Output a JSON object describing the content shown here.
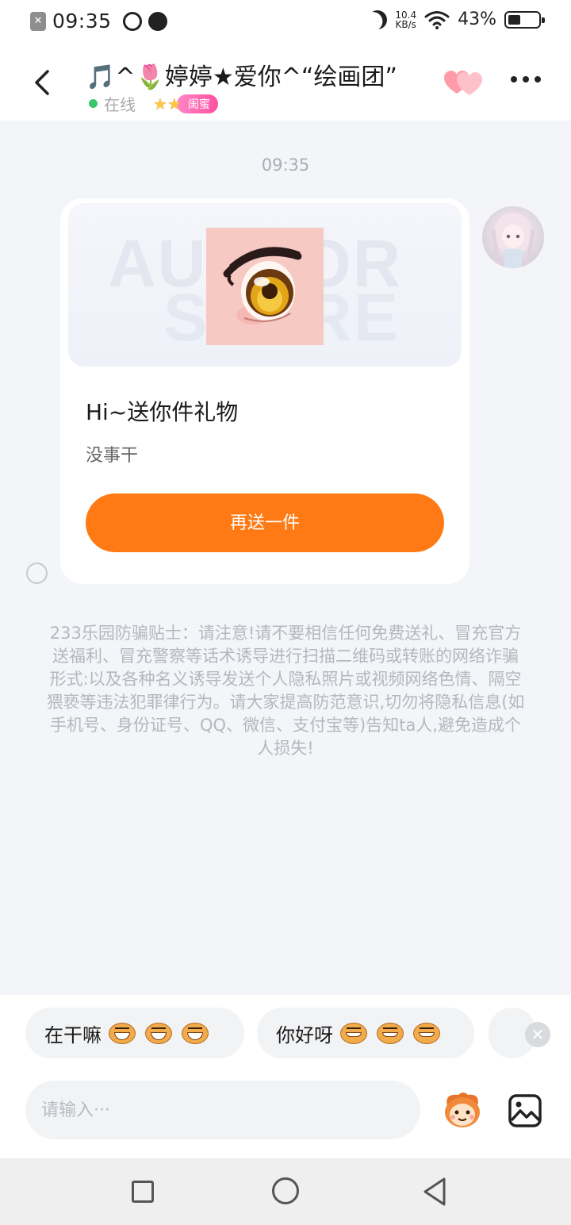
{
  "status_bar": {
    "time": "09:35",
    "net_speed_value": "10.4",
    "net_speed_unit": "KB/s",
    "battery_percent": "43%",
    "battery_level": 0.43
  },
  "header": {
    "title": "🎵^🌷婷婷★爱你^“绘画团”",
    "online_status": "在线",
    "relationship_badge": "闺蜜"
  },
  "chat": {
    "timestamp": "09:35",
    "gift_card": {
      "title": "Hi~送你件礼物",
      "subtitle": "没事干",
      "resend_label": "再送一件",
      "watermark_line1": "AUTHOR",
      "watermark_line2": "STORE"
    },
    "warning": "233乐园防骗贴士：请注意!请不要相信任何免费送礼、冒充官方送福利、冒充警察等话术诱导进行扫描二维码或转账的网络诈骗形式:以及各种名义诱导发送个人隐私照片或视频网络色情、隔空猥亵等违法犯罪律行为。请大家提高防范意识,切勿将隐私信息(如手机号、身份证号、QQ、微信、支付宝等)告知ta人,避免造成个人损失!"
  },
  "quick_replies": [
    {
      "text": "在干嘛"
    },
    {
      "text": "你好呀"
    }
  ],
  "input": {
    "placeholder": "请输入···"
  },
  "colors": {
    "accent": "#ff7a14",
    "online_dot": "#3cc46a",
    "badge": "#ff4fa0",
    "background": "#f3f5f8"
  },
  "icons": {
    "back": "chevron-left-icon",
    "hearts": "hearts-icon",
    "more": "more-dots-icon",
    "emoji": "monkey-emoji-icon",
    "image": "image-icon"
  }
}
